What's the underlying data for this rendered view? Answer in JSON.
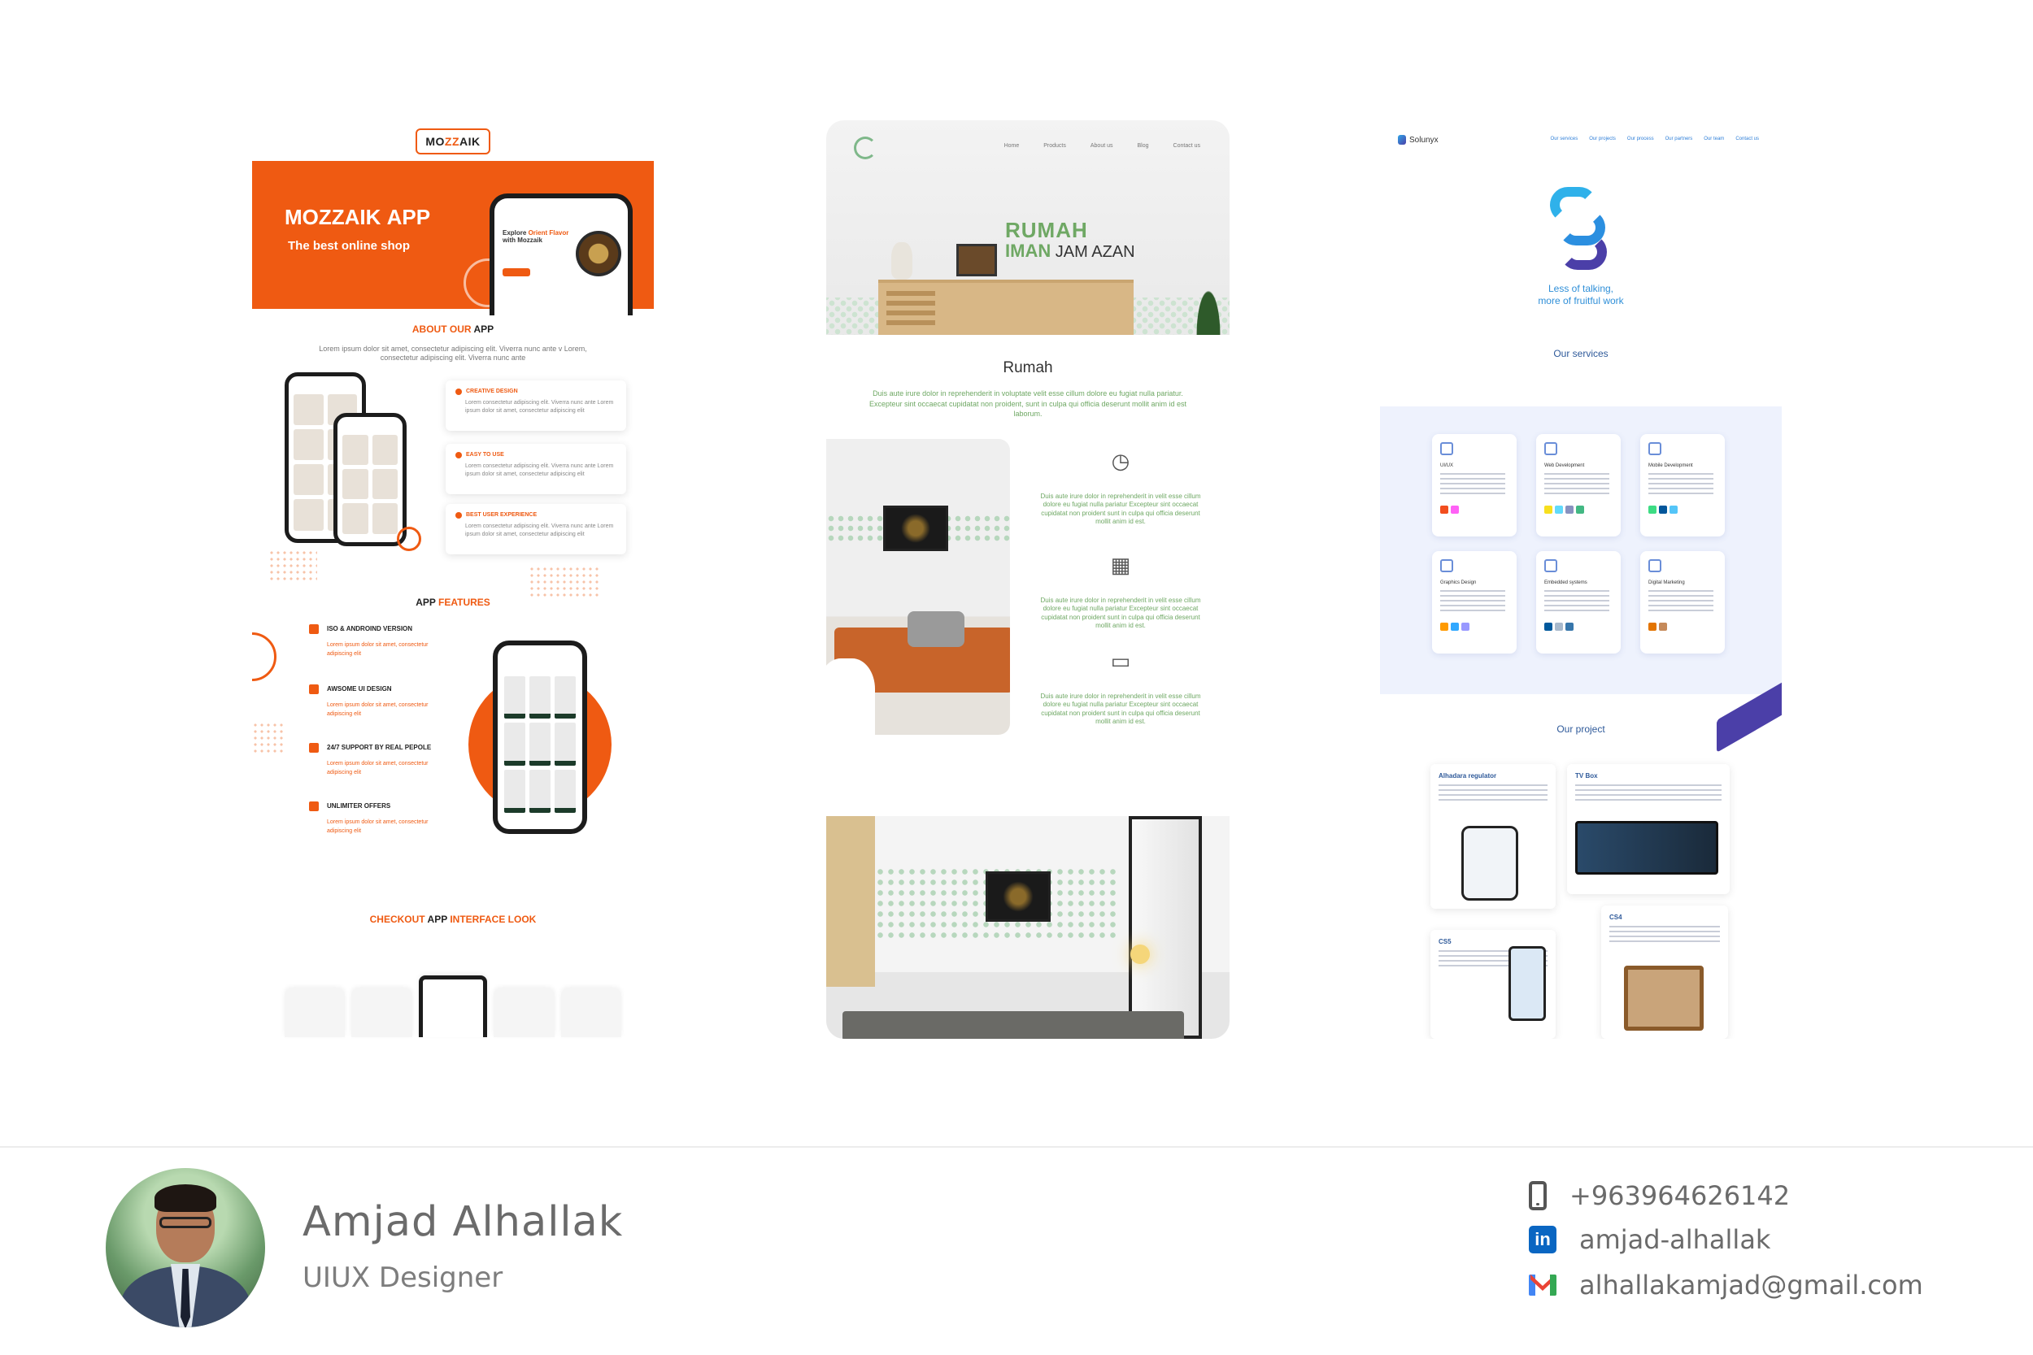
{
  "mozzaik": {
    "logo_pre": "MO",
    "logo_mid": "ZZ",
    "logo_post": "AIK",
    "hero_title_a": "MOZZAIK ",
    "hero_title_b": "APP",
    "hero_sub": "The best online shop",
    "phone_text_a": "Explore ",
    "phone_text_b": "Orient Flavor",
    "phone_text_c": "with Mozzaik",
    "about_a": "ABOUT ",
    "about_b": "OUR ",
    "about_c": "APP",
    "about_lorem": "Lorem ipsum dolor sit amet, consectetur adipiscing elit. Viverra nunc ante v Lorem, consectetur adipiscing elit. Viverra nunc ante",
    "cards": [
      {
        "title": "CREATIVE DESIGN",
        "desc": "Lorem consectetur adipiscing elit. Viverra nunc ante Lorem ipsum dolor sit amet, consectetur adipiscing elit"
      },
      {
        "title": "EASY TO USE",
        "desc": "Lorem consectetur adipiscing elit. Viverra nunc ante Lorem ipsum dolor sit amet, consectetur adipiscing elit"
      },
      {
        "title": "BEST USER EXPERIENCE",
        "desc": "Lorem consectetur adipiscing elit. Viverra nunc ante Lorem ipsum dolor sit amet, consectetur adipiscing elit"
      }
    ],
    "features_a": "APP ",
    "features_b": "FEATURES",
    "features": [
      {
        "title": "ISO & ANDROIND VERSION",
        "desc": "Lorem ipsum dolor sit amet, consectetur adipiscing elit"
      },
      {
        "title": "AWSOME UI DESIGN",
        "desc": "Lorem ipsum dolor sit amet, consectetur adipiscing elit"
      },
      {
        "title": "24/7 SUPPORT BY REAL PEPOLE",
        "desc": "Lorem ipsum dolor sit amet, consectetur adipiscing elit"
      },
      {
        "title": "UNLIMITER OFFERS",
        "desc": "Lorem ipsum dolor sit amet, consectetur adipiscing elit"
      }
    ],
    "checkout_a": "CHECKOUT ",
    "checkout_b": "APP ",
    "checkout_c": "INTERFACE LOOK"
  },
  "rumah": {
    "nav": [
      "Home",
      "Products",
      "About us",
      "Blog",
      "Contact us"
    ],
    "title1": "RUMAH",
    "title2_a": "IMAN",
    "title2_b": " JAM AZAN",
    "heading": "Rumah",
    "lorem": "Duis aute irure dolor in reprehenderit in voluptate velit esse cillum dolore eu fugiat nulla pariatur. Excepteur sint occaecat cupidatat non proident, sunt in culpa qui officia deserunt mollit anim id est laborum.",
    "feat_text": "Duis aute irure dolor in reprehenderit in velit esse cillum dolore eu fugiat nulla pariatur Excepteur sint occaecat cupidatat non proident sunt in culpa qui officia deserunt mollit anim id est."
  },
  "solunyx": {
    "brand": "Solunyx",
    "links": [
      "Our services",
      "Our projects",
      "Our process",
      "Our partners",
      "Our team",
      "Contact us"
    ],
    "tag1": "Less of talking,",
    "tag2": "more of fruitful work",
    "services_h": "Our services",
    "services": [
      "UI/UX",
      "Web Development",
      "Mobile Development",
      "Graphics Design",
      "Embedded systems",
      "Digital Marketing"
    ],
    "project_h": "Our  project",
    "projects": [
      "Alhadara regulator",
      "TV Box",
      "CS5",
      "CS4"
    ]
  },
  "profile": {
    "name": "Amjad Alhallak",
    "role": "UIUX Designer",
    "phone": "+963964626142",
    "linkedin": "amjad-alhallak",
    "email": "alhallakamjad@gmail.com"
  },
  "colors": {
    "mozzaik_orange": "#ef5a12",
    "rumah_green": "#6fa864",
    "solunyx_blue": "#2f8fd8",
    "solunyx_purple": "#4b3fa8"
  }
}
